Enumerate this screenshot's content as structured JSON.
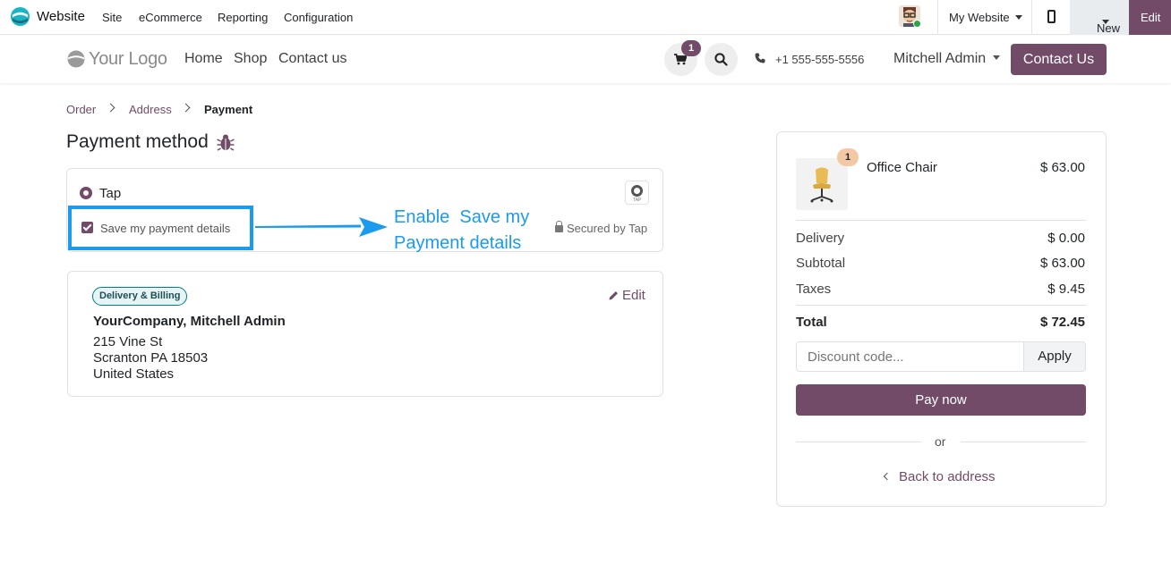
{
  "admin_bar": {
    "app_name": "Website",
    "menus": [
      "Site",
      "eCommerce",
      "Reporting",
      "Configuration"
    ],
    "website_selector": "My Website",
    "new_label": "New",
    "edit_label": "Edit"
  },
  "site_header": {
    "logo_text": "Your Logo",
    "nav": [
      "Home",
      "Shop",
      "Contact us"
    ],
    "cart_count": "1",
    "phone": "+1 555-555-5556",
    "user": "Mitchell Admin",
    "contact_button": "Contact Us"
  },
  "breadcrumb": [
    "Order",
    "Address",
    "Payment"
  ],
  "payment": {
    "title": "Payment method",
    "provider": "Tap",
    "save_label": "Save my payment details",
    "secured_label": "Secured by Tap",
    "provider_logo_text": "TAP"
  },
  "annotation": {
    "line1": "Enable  Save my",
    "line2": "Payment details"
  },
  "address": {
    "badge": "Delivery & Billing",
    "edit_label": "Edit",
    "name": "YourCompany, Mitchell Admin",
    "lines": [
      "215 Vine St",
      "Scranton PA 18503",
      "United States"
    ]
  },
  "summary": {
    "product": {
      "quantity": "1",
      "name": "Office Chair",
      "price": "$ 63.00"
    },
    "rows": [
      {
        "label": "Delivery",
        "value": "$ 0.00"
      },
      {
        "label": "Subtotal",
        "value": "$ 63.00"
      },
      {
        "label": "Taxes",
        "value": "$ 9.45"
      }
    ],
    "total": {
      "label": "Total",
      "value": "$ 72.45"
    },
    "discount_placeholder": "Discount code...",
    "apply_label": "Apply",
    "pay_label": "Pay now",
    "or_label": "or",
    "back_label": "Back to address"
  },
  "colors": {
    "brand": "#714B67",
    "annotation": "#1a9bf0"
  }
}
